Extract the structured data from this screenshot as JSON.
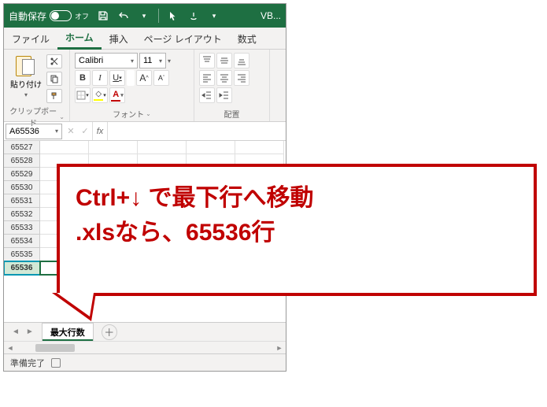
{
  "titlebar": {
    "autosave_label": "自動保存",
    "autosave_state": "オフ",
    "app_title_fragment": "VB..."
  },
  "tabs": {
    "items": [
      "ファイル",
      "ホーム",
      "挿入",
      "ページ レイアウト",
      "数式"
    ],
    "active_index": 1
  },
  "ribbon": {
    "clipboard": {
      "paste_label": "貼り付け",
      "group_label": "クリップボード"
    },
    "font": {
      "name": "Calibri",
      "size": "11",
      "group_label": "フォント",
      "bold": "B",
      "italic": "I",
      "underline": "U",
      "grow": "A",
      "shrink": "A"
    },
    "align": {
      "group_label": "配置"
    }
  },
  "namebox": {
    "value": "A65536"
  },
  "formula": {
    "fx_label": "fx"
  },
  "rows": [
    "65527",
    "65528",
    "65529",
    "65530",
    "65531",
    "65532",
    "65533",
    "65534",
    "65535",
    "65536"
  ],
  "selected_row": "65536",
  "sheet": {
    "name": "最大行数"
  },
  "status": {
    "ready": "準備完了"
  },
  "annotation": {
    "line1": "Ctrl+↓ で最下行へ移動",
    "line2": ".xlsなら、65536行"
  },
  "colors": {
    "excel_green": "#1e6f42",
    "callout_red": "#c00000"
  }
}
